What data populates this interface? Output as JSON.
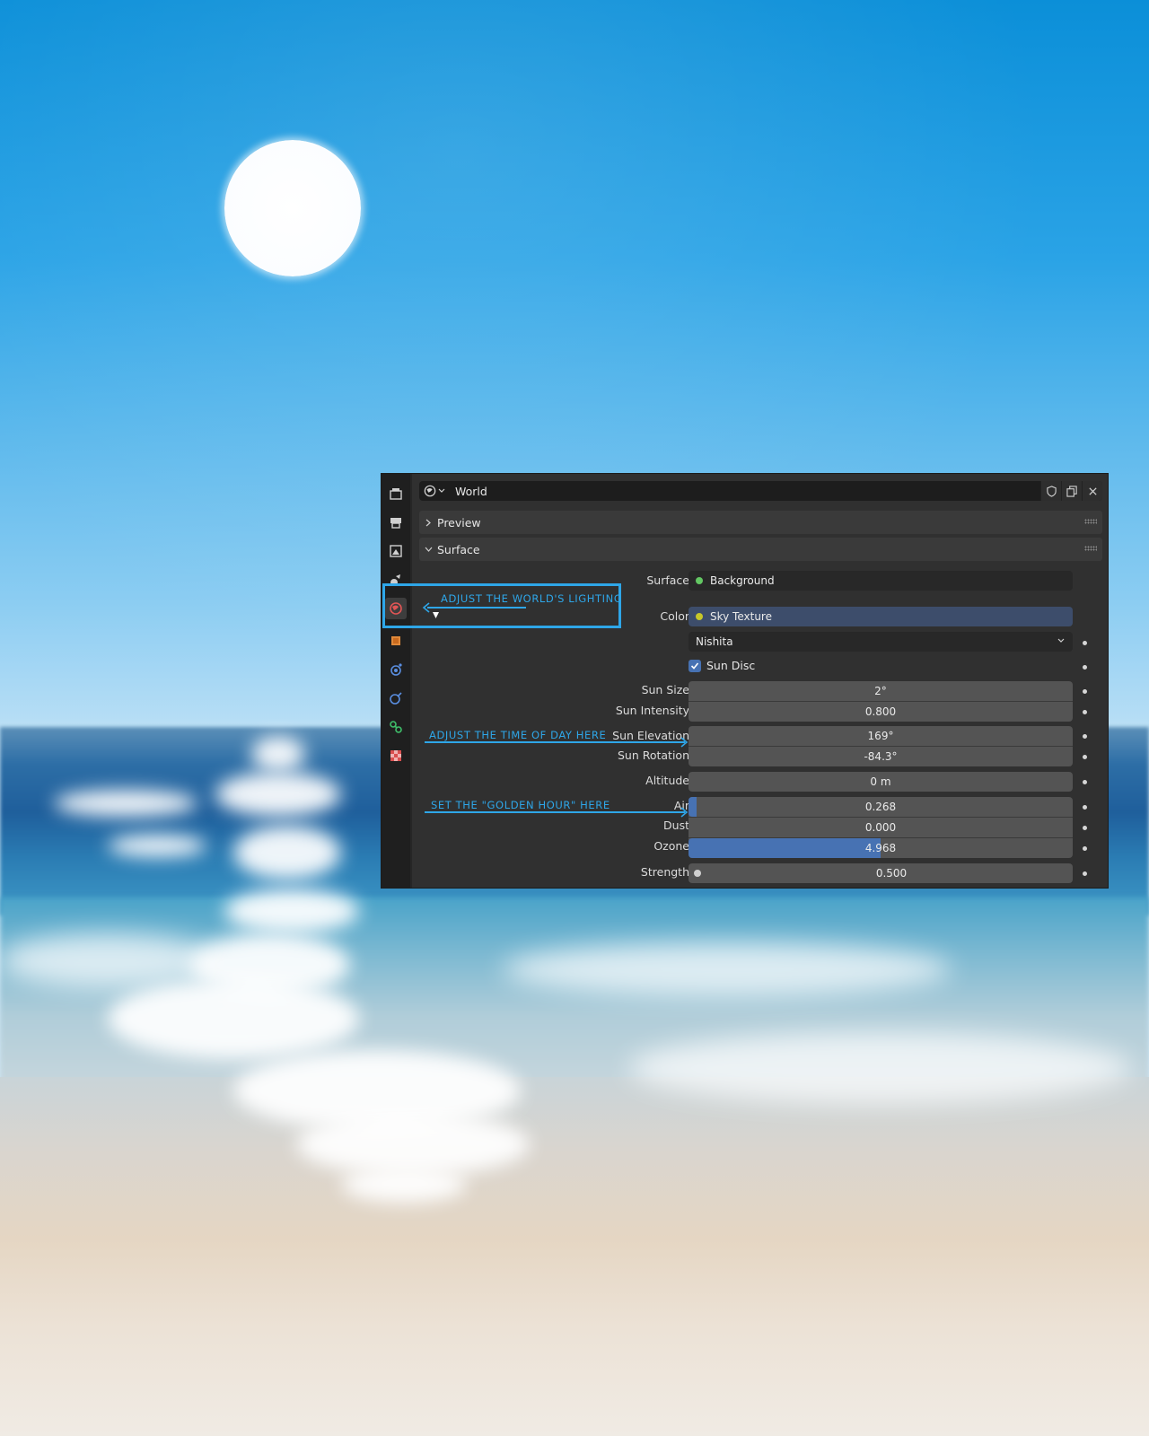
{
  "panel": {
    "world_name": "World",
    "sections": {
      "preview": "Preview",
      "surface": "Surface"
    },
    "properties": {
      "surface_label": "Surface",
      "surface_value": "Background",
      "color_label": "Color",
      "color_value": "Sky Texture",
      "sky_type": "Nishita",
      "sun_disc_label": "Sun Disc",
      "sun_disc_checked": true,
      "sun_size_label": "Sun Size",
      "sun_size": "2°",
      "sun_intensity_label": "Sun Intensity",
      "sun_intensity": "0.800",
      "sun_elevation_label": "Sun Elevation",
      "sun_elevation": "169°",
      "sun_rotation_label": "Sun Rotation",
      "sun_rotation": "-84.3°",
      "altitude_label": "Altitude",
      "altitude": "0 m",
      "air_label": "Air",
      "air": "0.268",
      "air_fill": 0.02,
      "dust_label": "Dust",
      "dust": "0.000",
      "ozone_label": "Ozone",
      "ozone": "4.968",
      "ozone_fill": 0.5,
      "strength_label": "Strength",
      "strength": "0.500"
    },
    "side_tabs": [
      "render-tab-icon",
      "output-tab-icon",
      "view-layer-tab-icon",
      "scene-tab-icon",
      "world-tab-icon",
      "object-tab-icon",
      "modifiers-tab-icon",
      "physics-tab-icon",
      "constraints-tab-icon",
      "texture-tab-icon"
    ]
  },
  "annotations": {
    "world_lighting": "ADJUST THE WORLD'S LIGHTING",
    "time_of_day": "ADJUST THE TIME OF DAY HERE",
    "golden_hour": "SET THE \"GOLDEN HOUR\" HERE"
  },
  "colors": {
    "accent_blue": "#4772b3",
    "annotation_blue": "#2ea6e8",
    "socket_green": "#63c763",
    "socket_yellow": "#c7c729"
  }
}
